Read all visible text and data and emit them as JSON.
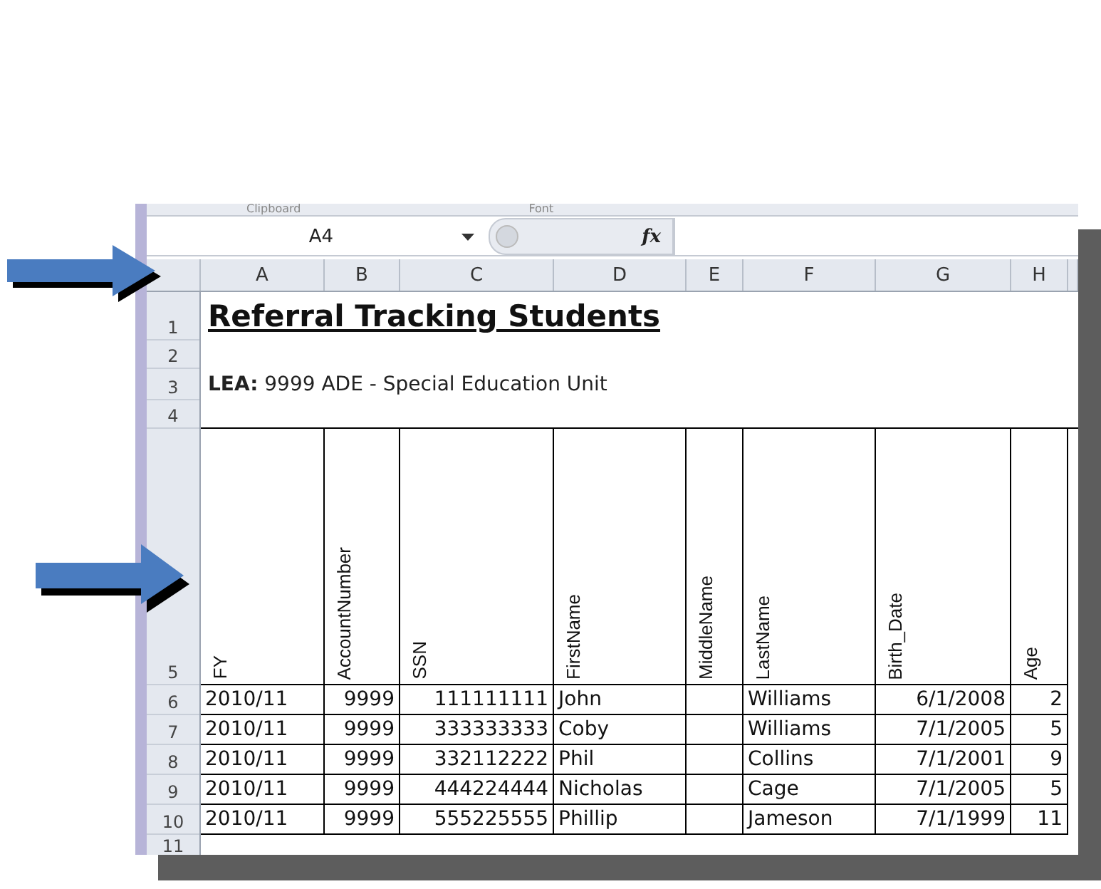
{
  "ribbon_groups": [
    "Clipboard",
    "Font"
  ],
  "name_box": "A4",
  "formula_bar": {
    "function_label": "fx"
  },
  "column_letters": [
    "A",
    "B",
    "C",
    "D",
    "E",
    "F",
    "G",
    "H"
  ],
  "title": "Referral Tracking Students",
  "subtitle": "**LEA:** 9999 ADE - Special Education Unit",
  "table": {
    "columns": [
      {
        "header": "FY",
        "kind": "text"
      },
      {
        "header": "AccountNumber",
        "kind": "number"
      },
      {
        "header": "SSN",
        "kind": "number"
      },
      {
        "header": "FirstName",
        "kind": "text"
      },
      {
        "header": "MiddleName",
        "kind": "text"
      },
      {
        "header": "LastName",
        "kind": "text"
      },
      {
        "header": "Birth_Date",
        "kind": "number"
      },
      {
        "header": "Age",
        "kind": "number"
      }
    ],
    "rows": [
      [
        "2010/11",
        "9999",
        "111111111",
        "John",
        "",
        "Williams",
        "6/1/2008",
        "2"
      ],
      [
        "2010/11",
        "9999",
        "333333333",
        "Coby",
        "",
        "Williams",
        "7/1/2005",
        "5"
      ],
      [
        "2010/11",
        "9999",
        "332112222",
        "Phil",
        "",
        "Collins",
        "7/1/2001",
        "9"
      ],
      [
        "2010/11",
        "9999",
        "444224444",
        "Nicholas",
        "",
        "Cage",
        "7/1/2005",
        "5"
      ],
      [
        "2010/11",
        "9999",
        "555225555",
        "Phillip",
        "",
        "Jameson",
        "7/1/1999",
        "11"
      ]
    ]
  },
  "row_numbers": [
    "1",
    "2",
    "3",
    "4",
    "5",
    "6",
    "7",
    "8",
    "9",
    "10",
    "11"
  ]
}
